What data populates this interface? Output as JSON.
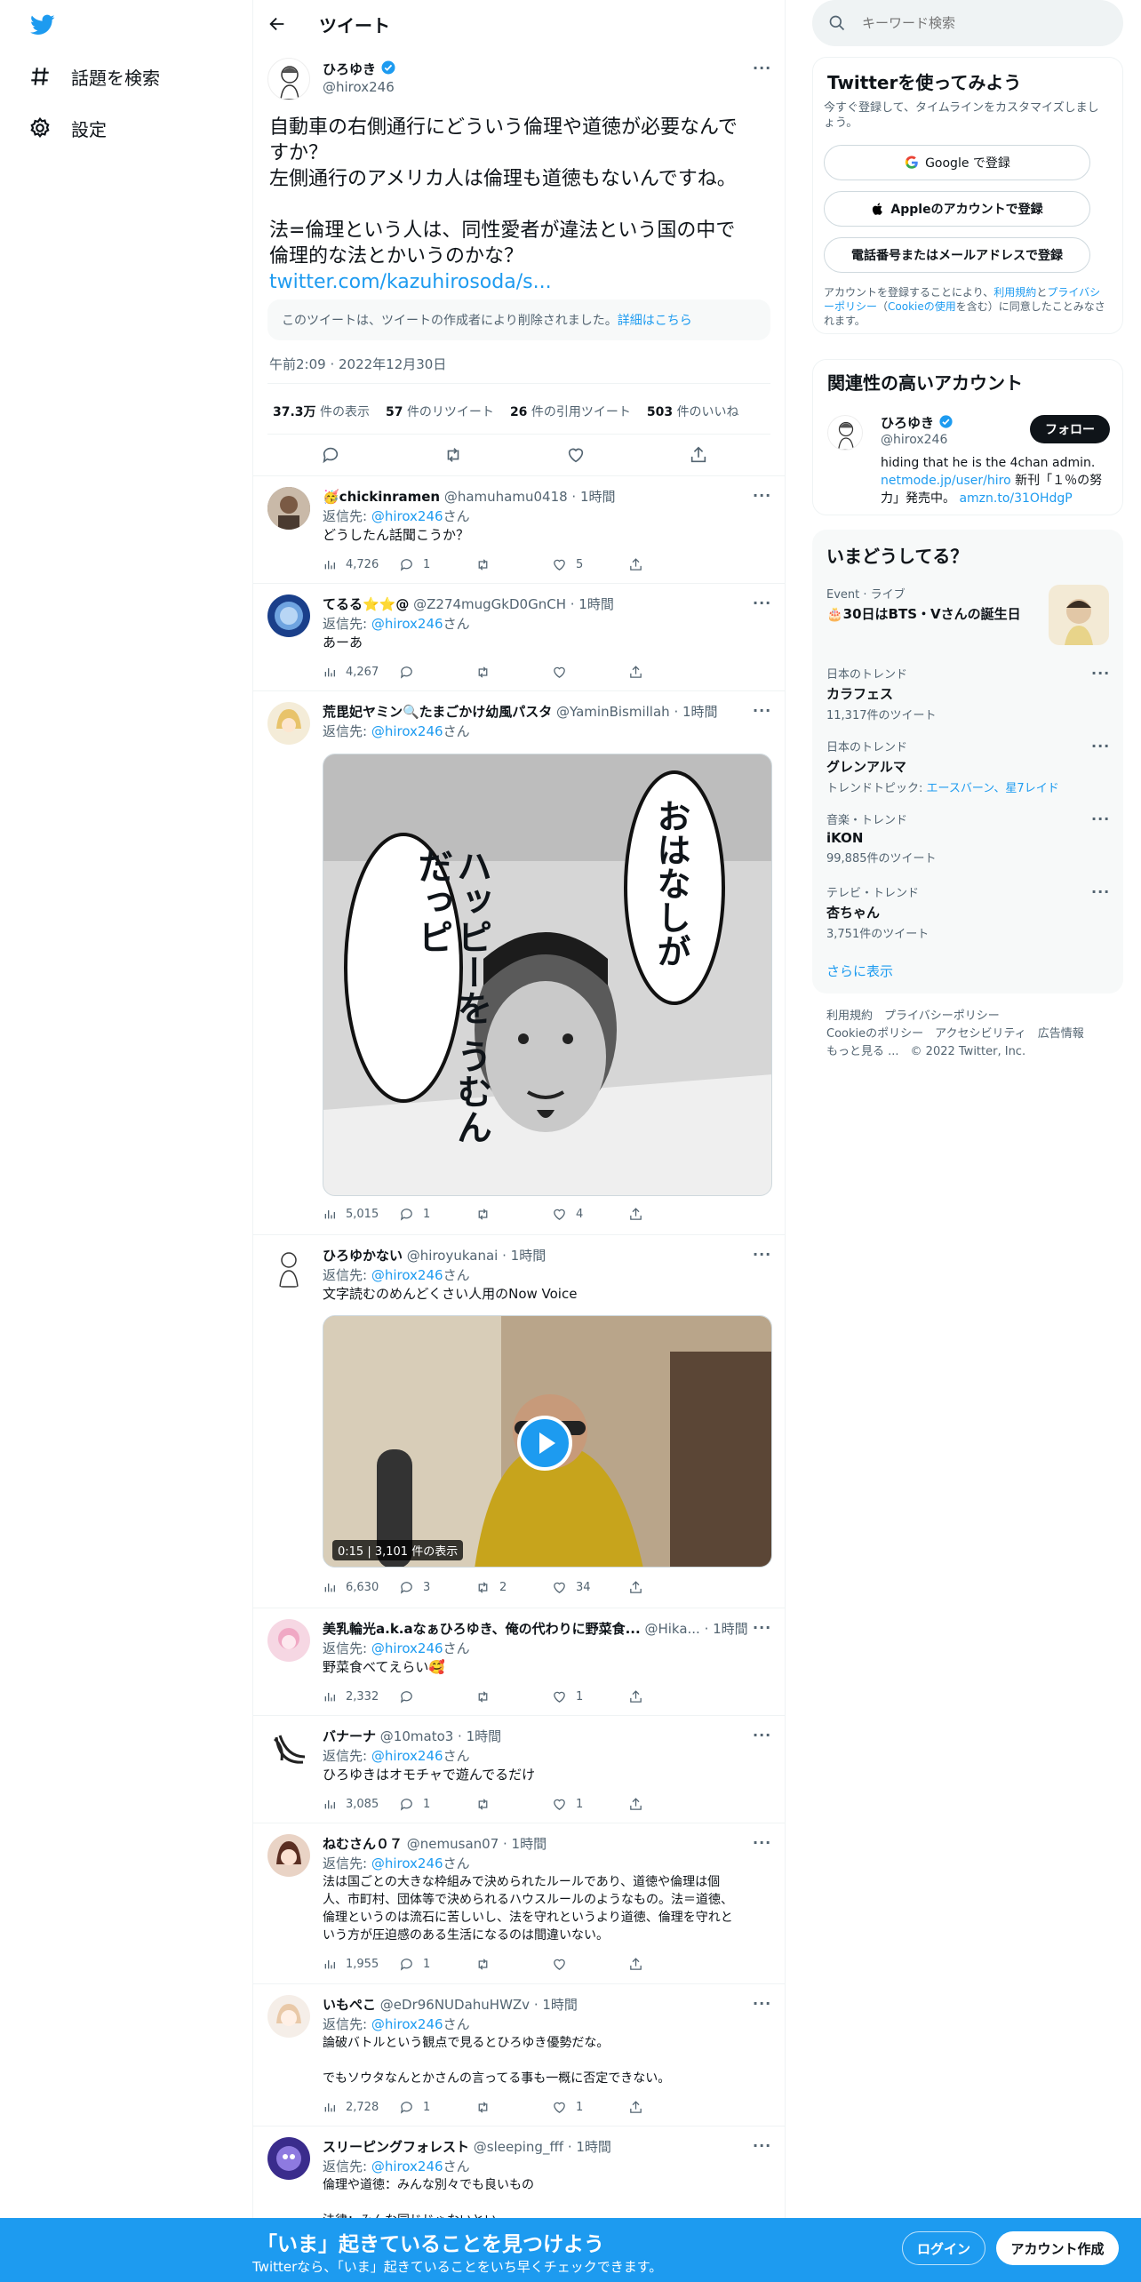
{
  "nav": {
    "explore": "話題を検索",
    "settings": "設定"
  },
  "header": {
    "title": "ツイート"
  },
  "main_tweet": {
    "name": "ひろゆき",
    "handle": "@hirox246",
    "line1": "自動車の右側通行にどういう倫理や道徳が必要なんで",
    "line2": "すか？",
    "line3": "左側通行のアメリカ人は倫理も道徳もないんですね。",
    "line4": "法=倫理という人は、同性愛者が違法という国の中で",
    "line5": "倫理的な法とかいうのかな？",
    "link": "twitter.com/kazuhirosoda/s...",
    "deleted_notice": "このツイートは、ツイートの作成者により削除されました。",
    "deleted_link": "詳細はこちら",
    "timestamp": "午前2:09 · 2022年12月30日",
    "views_num": "37.3万",
    "views_label": "件の表示",
    "retweets_num": "57",
    "retweets_label": "件のリツイート",
    "quotes_num": "26",
    "quotes_label": "件の引用ツイート",
    "likes_num": "503",
    "likes_label": "件のいいね"
  },
  "replies": [
    {
      "name": "🥳chickinramen",
      "handle": "@hamuhamu0418 · 1時間",
      "reply_to": "返信先: ",
      "reply_handle": "@hirox246",
      "reply_suffix": "さん",
      "text": "どうしたん話聞こうか？",
      "views": "4,726",
      "replies": "1",
      "retweets": "",
      "likes": "5"
    },
    {
      "name": "てるる⭐⭐@",
      "handle": "@Z274mugGkD0GnCH · 1時間",
      "reply_to": "返信先: ",
      "reply_handle": "@hirox246",
      "reply_suffix": "さん",
      "text": "あーあ",
      "views": "4,267",
      "replies": "",
      "retweets": "",
      "likes": ""
    },
    {
      "name": "荒毘妃ヤミン🔍たまごかけ幼風パスタ",
      "handle": "@YaminBismillah · 1時間",
      "reply_to": "返信先: ",
      "reply_handle": "@hirox246",
      "reply_suffix": "さん",
      "text": "",
      "bubble1": "ハッピーを うむんだっピ",
      "bubble2": "おはなしが",
      "views": "5,015",
      "replies": "1",
      "retweets": "",
      "likes": "4"
    },
    {
      "name": "ひろゆかない",
      "handle": "@hiroyukanai · 1時間",
      "reply_to": "返信先: ",
      "reply_handle": "@hirox246",
      "reply_suffix": "さん",
      "text": "文字読むのめんどくさい人用のNow Voice",
      "video_time": "0:15",
      "video_views": "3,101 件の表示",
      "views": "6,630",
      "replies": "3",
      "retweets": "2",
      "likes": "34"
    },
    {
      "name": "美乳輪光a.k.aなぁひろゆき、俺の代わりに野菜食...",
      "handle": "@Hika... · 1時間",
      "reply_to": "返信先: ",
      "reply_handle": "@hirox246",
      "reply_suffix": "さん",
      "text": "野菜食べてえらい🥰",
      "views": "2,332",
      "replies": "",
      "retweets": "",
      "likes": "1"
    },
    {
      "name": "バナーナ",
      "handle": "@10mato3 · 1時間",
      "reply_to": "返信先: ",
      "reply_handle": "@hirox246",
      "reply_suffix": "さん",
      "text": "ひろゆきはオモチャで遊んでるだけ",
      "views": "3,085",
      "replies": "1",
      "retweets": "",
      "likes": "1"
    },
    {
      "name": "ねむさん０７",
      "handle": "@nemusan07 · 1時間",
      "reply_to": "返信先: ",
      "reply_handle": "@hirox246",
      "reply_suffix": "さん",
      "text_l1": "法は国ごとの大きな枠組みで決められたルールであり、道徳や倫理は個",
      "text_l2": "人、市町村、団体等で決められるハウスルールのようなもの。法＝道徳、",
      "text_l3": "倫理というのは流石に苦しいし、法を守れというより道徳、倫理を守れと",
      "text_l4": "いう方が圧迫感のある生活になるのは間違いない。",
      "views": "1,955",
      "replies": "1",
      "retweets": "",
      "likes": ""
    },
    {
      "name": "いもぺこ",
      "handle": "@eDr96NUDahuHWZv · 1時間",
      "reply_to": "返信先: ",
      "reply_handle": "@hirox246",
      "reply_suffix": "さん",
      "text_l1": "論破バトルという観点で見るとひろゆき優勢だな。",
      "text_l2": "でもソウタなんとかさんの言ってる事も一概に否定できない。",
      "views": "2,728",
      "replies": "1",
      "retweets": "",
      "likes": "1"
    },
    {
      "name": "スリーピングフォレスト",
      "handle": "@sleeping_fff · 1時間",
      "reply_to": "返信先: ",
      "reply_handle": "@hirox246",
      "reply_suffix": "さん",
      "text": "倫理や道徳：みんな別々でも良いもの",
      "text2": "法律：みんな同じじゃないとい"
    }
  ],
  "search": {
    "placeholder": "キーワード検索"
  },
  "signup_panel": {
    "title": "Twitterを使ってみよう",
    "desc_l1": "今すぐ登録して、タイムラインをカスタマイズしまし",
    "desc_l2": "ょう。",
    "google": "Google で登録",
    "apple": "Appleのアカウントで登録",
    "email": "電話番号またはメールアドレスで登録",
    "terms_a": "アカウントを登録することにより、",
    "terms_tos": "利用規約",
    "terms_and": "と",
    "terms_pp": "プライ",
    "terms_pp2": "バシーポリシー",
    "terms_b": "（",
    "terms_cookie": "Cookieの使用",
    "terms_c": "を含む）に同意したこと",
    "terms_d": "みなされます。"
  },
  "relevant": {
    "title": "関連性の高いアカウント",
    "name": "ひろゆき",
    "handle": "@hirox246",
    "follow": "フォロー",
    "bio1": "hiding that he is the 4chan admin.",
    "bio_link": "netmode.jp/user/hiro",
    "bio2": " 新刊「１％の努",
    "bio3": "力」発売中。",
    "bio_link2": "amzn.to/31OHdgP"
  },
  "trends": {
    "title": "いまどうしてる？",
    "items": [
      {
        "cat": "Event · ライブ",
        "title": "🎂30日はBTS・Vさんの誕生日",
        "count": ""
      },
      {
        "cat": "日本のトレンド",
        "title": "カラフェス",
        "count": "11,317件のツイート"
      },
      {
        "cat": "日本のトレンド",
        "title": "グレンアルマ",
        "count": "",
        "topic_label": "トレンドトピック: ",
        "topic": "エースバーン、星7レイド"
      },
      {
        "cat": "音楽・トレンド",
        "title": "iKON",
        "count": "99,885件のツイート"
      },
      {
        "cat": "テレビ・トレンド",
        "title": "杏ちゃん",
        "count": "3,751件のツイート"
      }
    ],
    "more": "さらに表示"
  },
  "footer": {
    "l1a": "利用規約",
    "l1b": "プライバシーポリシー",
    "l2a": "Cookieのポリシー",
    "l2b": "アクセシビリティ",
    "l2c": "広告情報",
    "l3a": "もっと見る ...",
    "l3b": "© 2022 Twitter, Inc."
  },
  "banner": {
    "headline": "「いま」起きていることを見つけよう",
    "sub": "Twitterなら、「いま」起きていることをいち早くチェックできます。",
    "login": "ログイン",
    "signup": "アカウント作成"
  },
  "colors": {
    "accent": "#1d9bf0",
    "text": "#0f1419",
    "muted": "#536471",
    "border": "#eff3f4"
  }
}
